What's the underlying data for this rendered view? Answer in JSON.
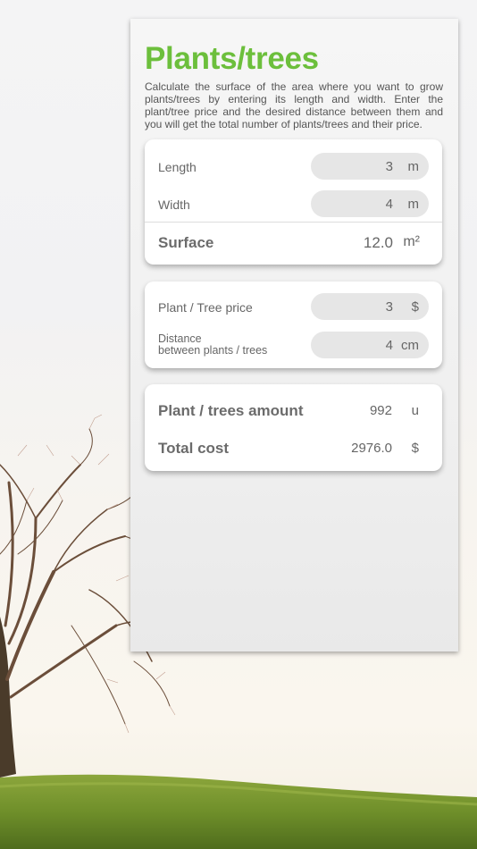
{
  "title": "Plants/trees",
  "description": "Calculate the surface of the area where you want to grow plants/trees by entering its length and width. Enter the plant/tree price and the desired distance between them and you will get the total number of plants/trees and their price.",
  "dimensions": {
    "length": {
      "label": "Length",
      "value": "3",
      "unit": "m"
    },
    "width": {
      "label": "Width",
      "value": "4",
      "unit": "m"
    },
    "surface": {
      "label": "Surface",
      "value": "12.0",
      "unit": "m²"
    }
  },
  "plant_inputs": {
    "price": {
      "label": "Plant / Tree price",
      "value": "3",
      "unit": "$"
    },
    "distance": {
      "label_line1": "Distance",
      "label_line2": "between plants / trees",
      "value": "4",
      "unit": "cm"
    }
  },
  "results": {
    "amount": {
      "label": "Plant / trees amount",
      "value": "992",
      "unit": "u"
    },
    "total": {
      "label": "Total cost",
      "value": "2976.0",
      "unit": "$"
    }
  },
  "colors": {
    "accent": "#6cbf3c",
    "text": "#666666",
    "pill": "#e6e6e6"
  },
  "icons": [
    "tree-illustration"
  ]
}
